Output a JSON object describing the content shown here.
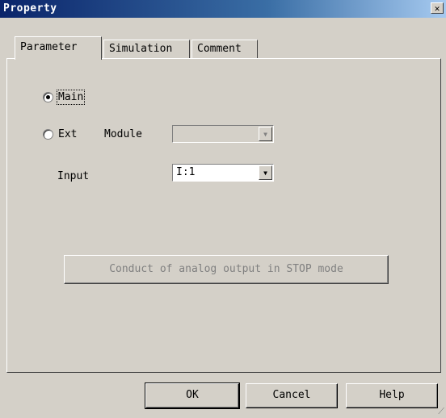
{
  "window": {
    "title": "Property",
    "close_glyph": "✕"
  },
  "tabs": [
    {
      "label": "Parameter",
      "active": true
    },
    {
      "label": "Simulation",
      "active": false
    },
    {
      "label": "Comment",
      "active": false
    }
  ],
  "parameter": {
    "main_label": "Main",
    "main_checked": true,
    "ext_label": "Ext",
    "module_label": "Module",
    "module_value": "",
    "input_label": "Input",
    "input_value": "I:1",
    "analog_button_label": "Conduct of analog output in STOP  mode"
  },
  "buttons": {
    "ok": "OK",
    "cancel": "Cancel",
    "help": "Help"
  },
  "icons": {
    "dropdown": "chevron-down-icon",
    "close": "close-icon",
    "grip": "resize-grip-icon"
  }
}
